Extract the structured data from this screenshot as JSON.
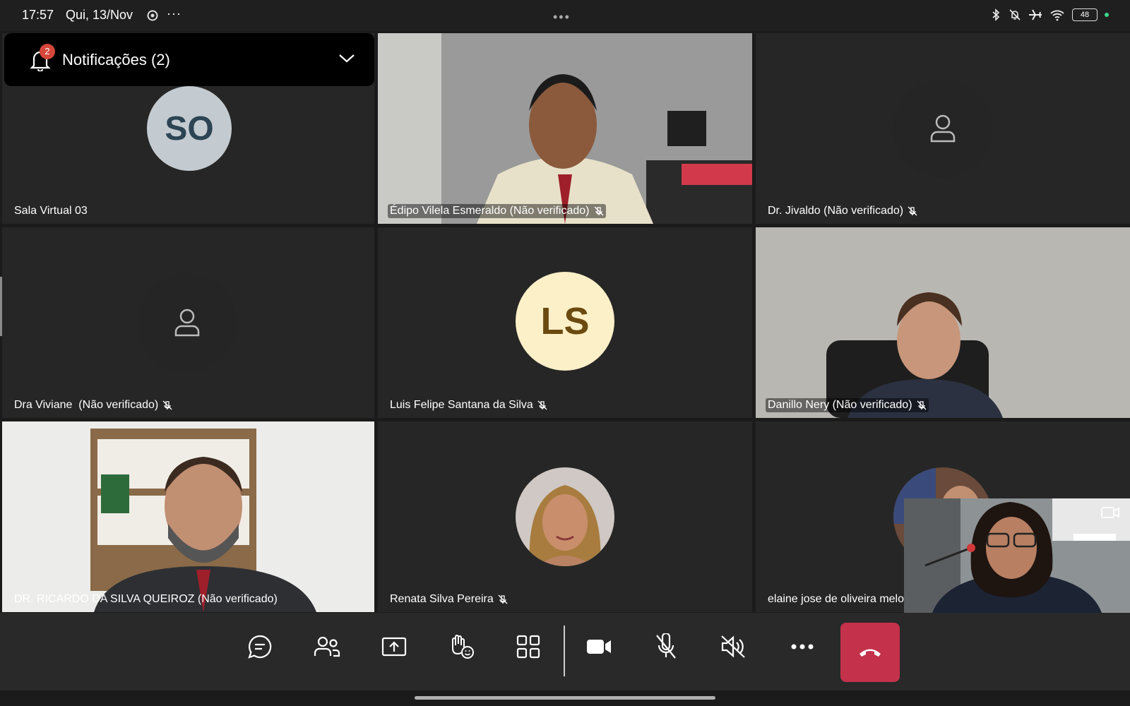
{
  "status_bar": {
    "time": "17:57",
    "date": "Qui, 13/Nov",
    "battery": "48",
    "icons": [
      "bluetooth-icon",
      "bell-off-icon",
      "airplane-icon",
      "wifi-icon",
      "battery-icon"
    ]
  },
  "notifications": {
    "label": "Notificações (2)",
    "badge": "2"
  },
  "tiles": [
    {
      "name": "Sala Virtual 03",
      "initials": "SO",
      "type": "initials"
    },
    {
      "name": "Édipo Vilela Esmeraldo (Não verificado)",
      "type": "video",
      "muted": true
    },
    {
      "name": "Dr. Jivaldo (Não verificado)",
      "type": "generic",
      "muted": true
    },
    {
      "name": "Dra Viviane  (Não verificado)",
      "type": "generic",
      "muted": true
    },
    {
      "name": "Luis Felipe Santana da Silva",
      "initials": "LS",
      "type": "initials",
      "muted": true
    },
    {
      "name": "Danillo Nery (Não verificado)",
      "type": "video",
      "muted": true
    },
    {
      "name": "DR. RICARDO DA SILVA QUEIROZ (Não verificado)",
      "type": "video"
    },
    {
      "name": "Renata Silva Pereira",
      "type": "photo",
      "muted": true
    },
    {
      "name": "elaine jose de oliveira melo",
      "type": "photo"
    }
  ],
  "toolbar": {
    "buttons": [
      "chat-button",
      "participants-button",
      "share-button",
      "react-button",
      "view-button",
      "camera-button",
      "mic-button",
      "speaker-button",
      "more-button",
      "hangup-button"
    ]
  },
  "colors": {
    "hangup": "#c4314b",
    "badge": "#d6473b",
    "avatar_so": "#c4cbd0",
    "avatar_ls": "#fcf0c8"
  }
}
